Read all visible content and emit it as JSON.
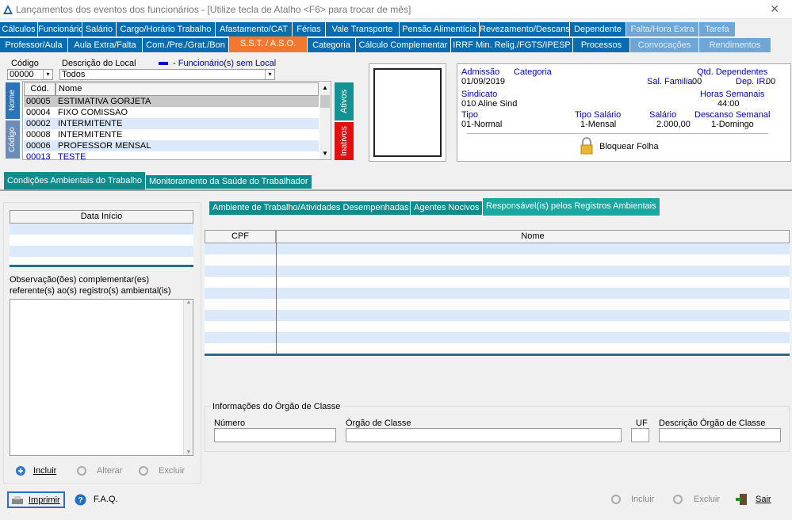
{
  "window": {
    "title": "Lançamentos dos eventos dos funcionários - [Utilize tecla de Atalho <F6> para trocar de mês]",
    "close": "✕"
  },
  "tabs_row1": [
    "Cálculos",
    "Funcionário",
    "Salário",
    "Cargo/Horário Trabalho",
    "Afastamento/CAT",
    "Férias",
    "Vale Transporte",
    "Pensão Alimentícia",
    "Revezamento/Descanso",
    "Dependente",
    "Falta/Hora Extra",
    "Tarefa"
  ],
  "tabs_row2": [
    "Professor/Aula",
    "Aula Extra/Falta",
    "Com./Pre./Grat./Bon",
    "S.S.T. / A.S.O.",
    "Categoria",
    "Cálculo Complementar",
    "IRRF Min. Relig./FGTS/IPESP",
    "Processos",
    "Convocações",
    "Rendimentos"
  ],
  "filter": {
    "codigo_label": "Código",
    "codigo_value": "00000",
    "descricao_label": "Descrição do Local",
    "descricao_value": "Todos",
    "legend": "- Funcionário(s) sem Local"
  },
  "emp_list": {
    "col_cod": "Cód.",
    "col_nome": "Nome",
    "side_nome": "Nome",
    "side_codigo": "Código",
    "side_ativos": "Ativos",
    "side_inativos": "Inativos",
    "rows": [
      {
        "cod": "00005",
        "nome": "ESTIMATIVA GORJETA"
      },
      {
        "cod": "00004",
        "nome": "FIXO COMISSAO"
      },
      {
        "cod": "00002",
        "nome": "INTERMITENTE"
      },
      {
        "cod": "00008",
        "nome": "INTERMITENTE"
      },
      {
        "cod": "00006",
        "nome": "PROFESSOR MENSAL"
      },
      {
        "cod": "00013",
        "nome": "TESTE"
      }
    ]
  },
  "info": {
    "admissao_label": "Admissão",
    "admissao": "01/09/2019",
    "categoria_label": "Categoria",
    "qtd_dep_label": "Qtd. Dependentes",
    "sal_familia": "Sal. Familia",
    "sal_familia_val": "00",
    "dep_ir": "Dep. IR.",
    "dep_ir_val": "00",
    "sindicato_label": "Sindicato",
    "sindicato": "010  Aline Sind",
    "horas_label": "Horas Semanais",
    "horas": "44:00",
    "tipo_label": "Tipo",
    "tipo": "01-Normal",
    "tipo_sal_label": "Tipo Salário",
    "tipo_sal": "1-Mensal",
    "salario_label": "Salário",
    "salario": "2.000,00",
    "descanso_label": "Descanso Semanal",
    "descanso": "1-Domingo",
    "bloquear": "Bloquear Folha"
  },
  "section_tabs": [
    "Condições Ambientais do Trabalho",
    "Monitoramento da Saúde do Trabalhador"
  ],
  "left": {
    "data_inicio": "Data Início",
    "obs_label1": "Observação(ões) complementar(es)",
    "obs_label2": "referente(s) ao(s) registro(s) ambiental(is)",
    "incluir": "Incluir",
    "alterar": "Alterar",
    "excluir": "Excluir"
  },
  "inner_tabs": [
    "Ambiente de Trabalho/Atividades Desempenhadas",
    "Agentes Nocivos",
    "Responsável(is) pelos Registros Ambientais"
  ],
  "resp_grid": {
    "cpf": "CPF",
    "nome": "Nome"
  },
  "orgao": {
    "title": "Informações do Órgão de Classe",
    "numero": "Número",
    "orgao": "Órgão de Classe",
    "uf": "UF",
    "descricao": "Descrição Órgão de Classe"
  },
  "footer": {
    "imprimir": "Imprimir",
    "faq": "F.A.Q.",
    "incluir": "Incluir",
    "excluir": "Excluir",
    "sair": "Sair"
  }
}
